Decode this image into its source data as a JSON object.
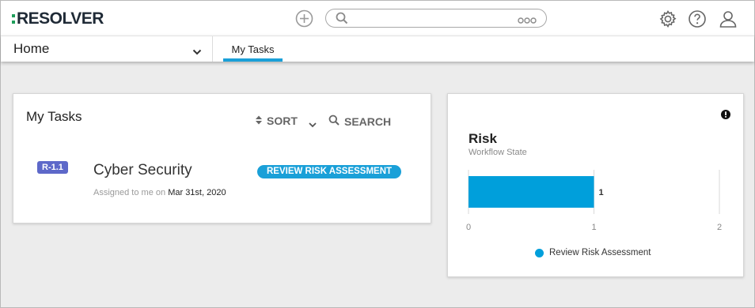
{
  "header": {
    "logo_text": "RESOLVER",
    "search_value": "",
    "brand_color": "#1aa0d8"
  },
  "nav": {
    "home_label": "Home",
    "tabs": [
      {
        "label": "My Tasks",
        "active": true
      }
    ]
  },
  "tasks": {
    "title": "My Tasks",
    "sort_label": "SORT",
    "search_label": "SEARCH",
    "items": [
      {
        "id": "R-1.1",
        "name": "Cyber Security",
        "assigned_prefix": "Assigned to me on",
        "assigned_date": "Mar 31st, 2020",
        "status": "REVIEW RISK ASSESSMENT"
      }
    ]
  },
  "risk": {
    "title": "Risk",
    "subtitle": "Workflow State",
    "legend_label": "Review Risk Assessment",
    "legend_color": "#009fdb"
  },
  "chart_data": {
    "type": "bar",
    "orientation": "horizontal",
    "categories": [
      "Review Risk Assessment"
    ],
    "series": [
      {
        "name": "Review Risk Assessment",
        "values": [
          1
        ],
        "color": "#009fdb"
      }
    ],
    "data_labels": [
      "1"
    ],
    "xticks": [
      "0",
      "1",
      "2"
    ],
    "xlim": [
      0,
      2
    ],
    "title": "Risk",
    "subtitle": "Workflow State",
    "legend": "bottom",
    "grid": true
  }
}
